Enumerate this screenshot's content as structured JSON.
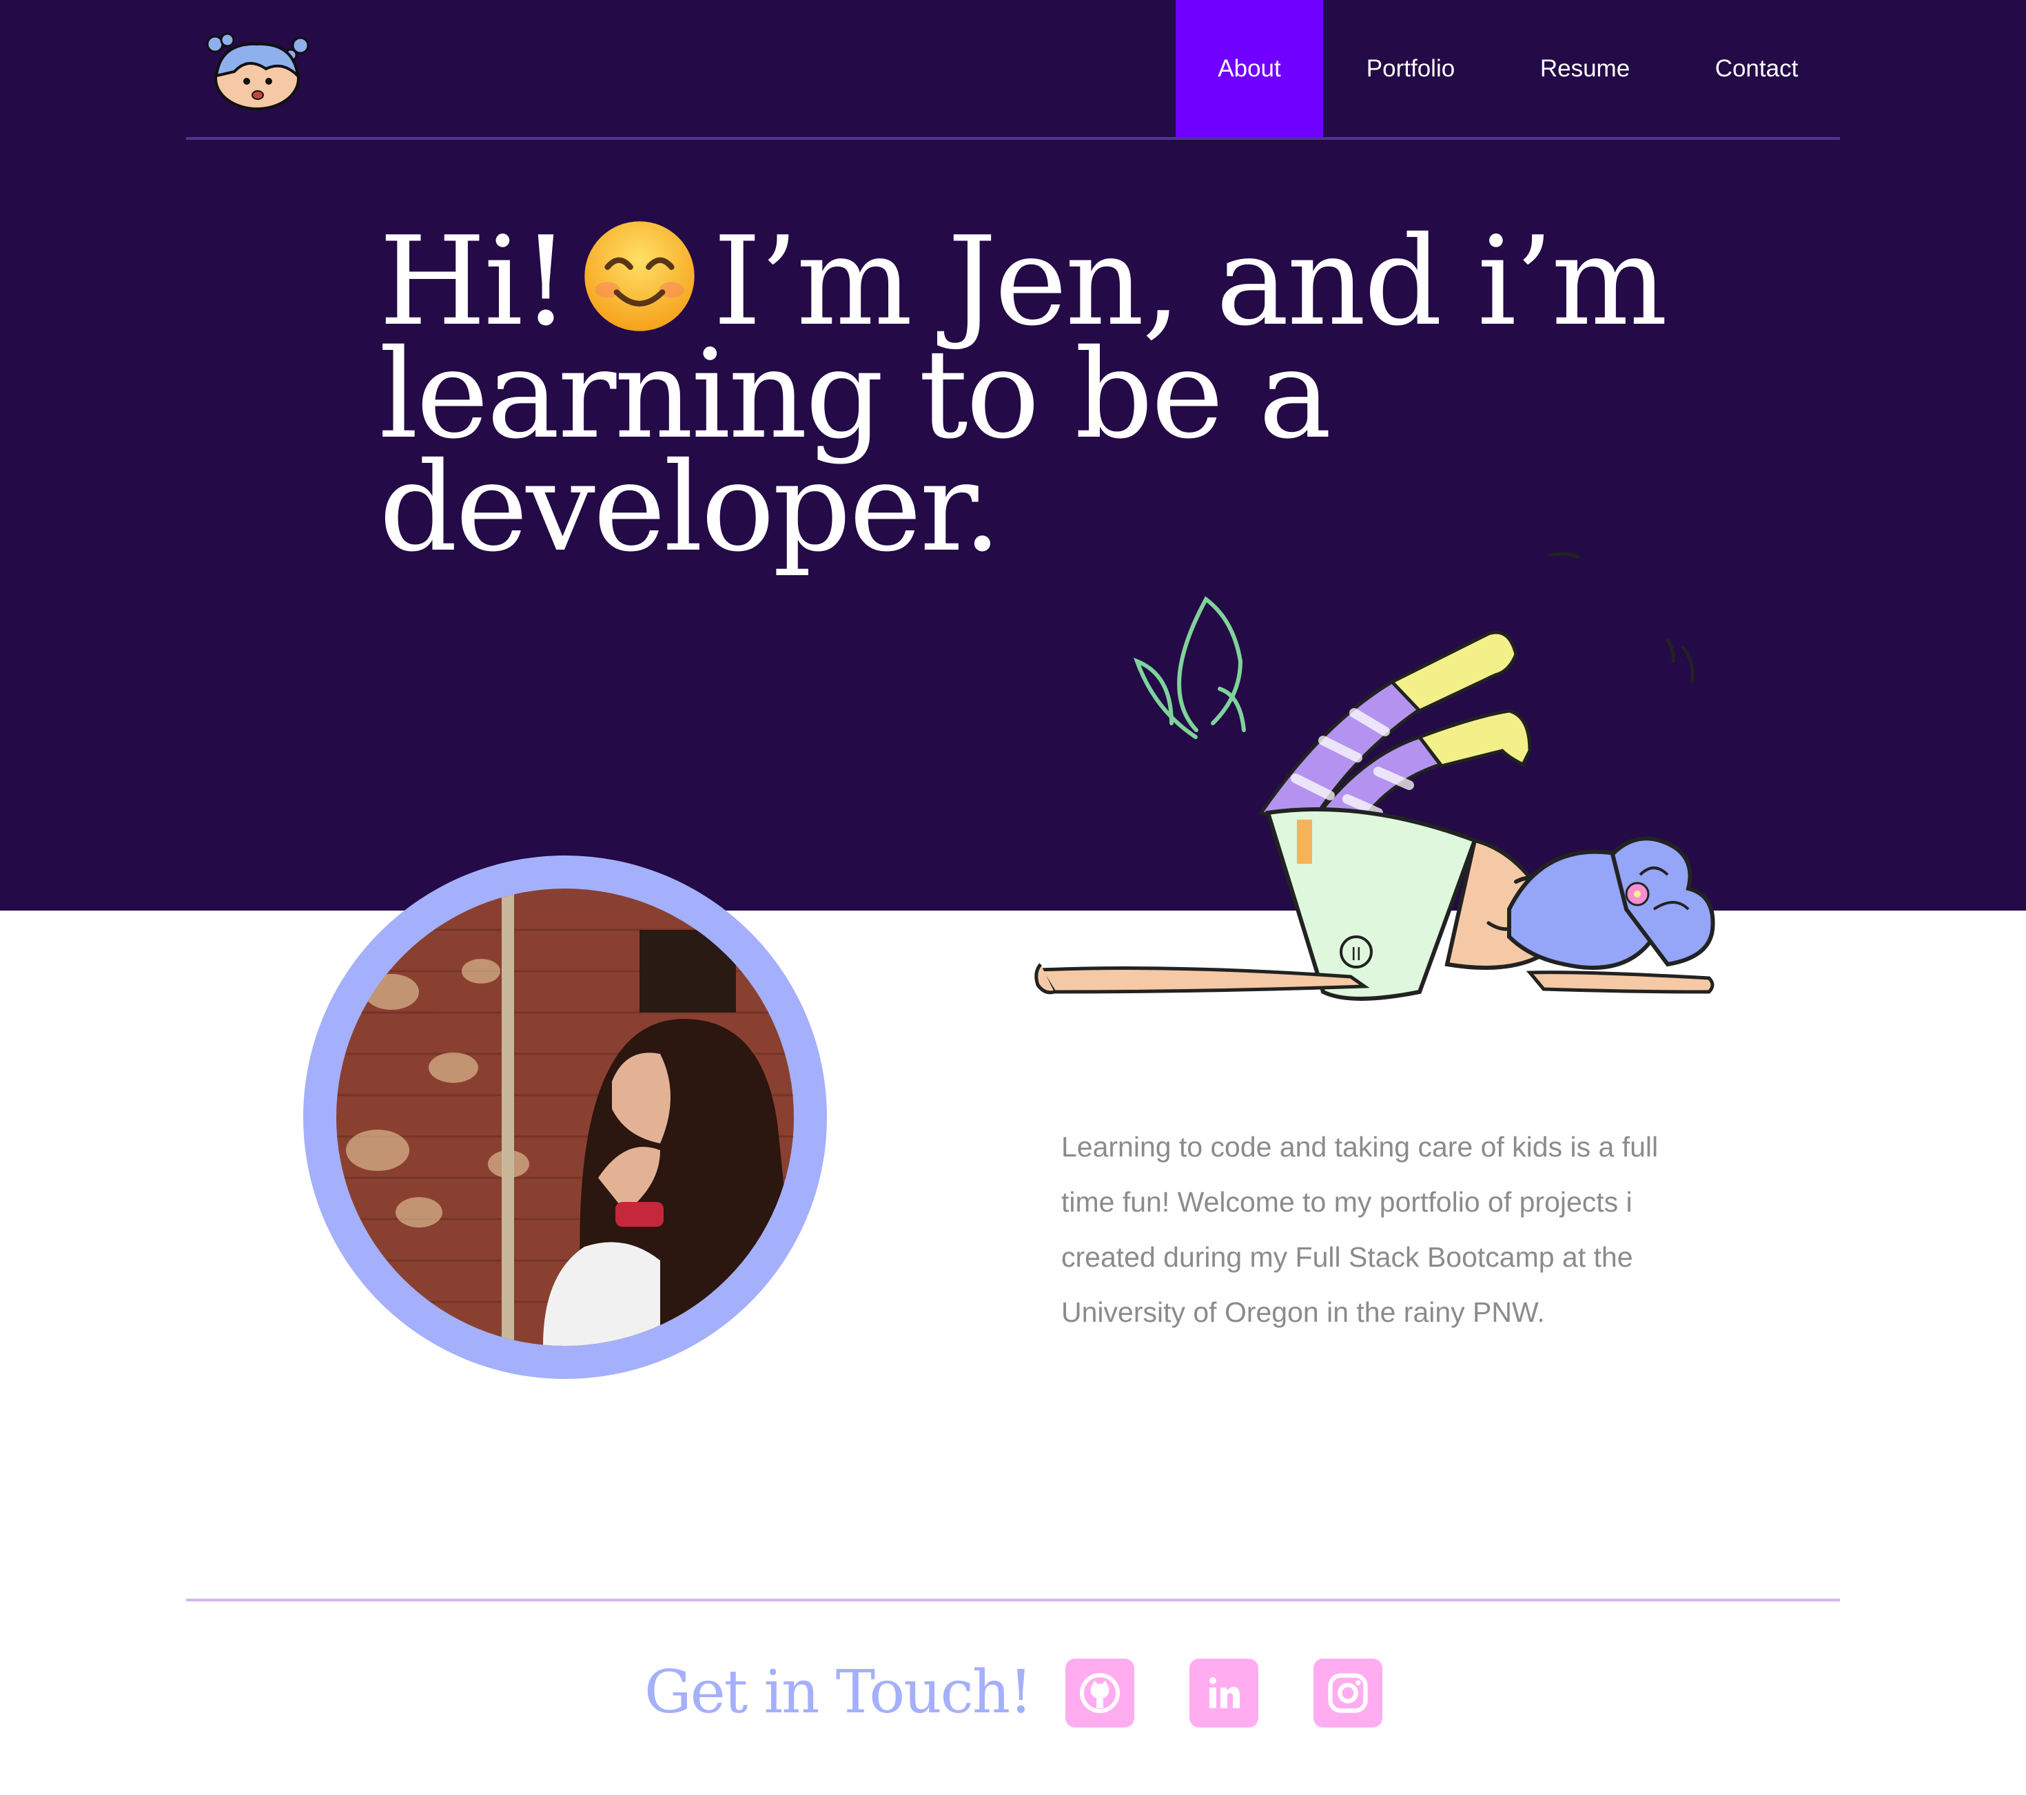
{
  "nav": {
    "items": [
      {
        "label": "About",
        "active": true
      },
      {
        "label": "Portfolio",
        "active": false
      },
      {
        "label": "Resume",
        "active": false
      },
      {
        "label": "Contact",
        "active": false
      }
    ]
  },
  "hero": {
    "headline_part1": "Hi!",
    "headline_part2": "I’m Jen, and i’m learning to be a developer.",
    "emoji": "smiling-face-icon"
  },
  "about": {
    "bio": "Learning to code and taking care of kids is a full time fun! Welcome to my portfolio of projects i created during my Full Stack Bootcamp at the University of Oregon in the rainy PNW."
  },
  "footer": {
    "title": "Get in Touch!",
    "social": [
      {
        "icon": "github-icon"
      },
      {
        "icon": "linkedin-icon"
      },
      {
        "icon": "instagram-icon"
      }
    ]
  },
  "colors": {
    "hero_bg": "#240a47",
    "nav_active": "#7000ff",
    "accent_lavender": "#a4b0fb",
    "social_pink": "#ffadf0",
    "body_text": "#8b8b8b"
  }
}
